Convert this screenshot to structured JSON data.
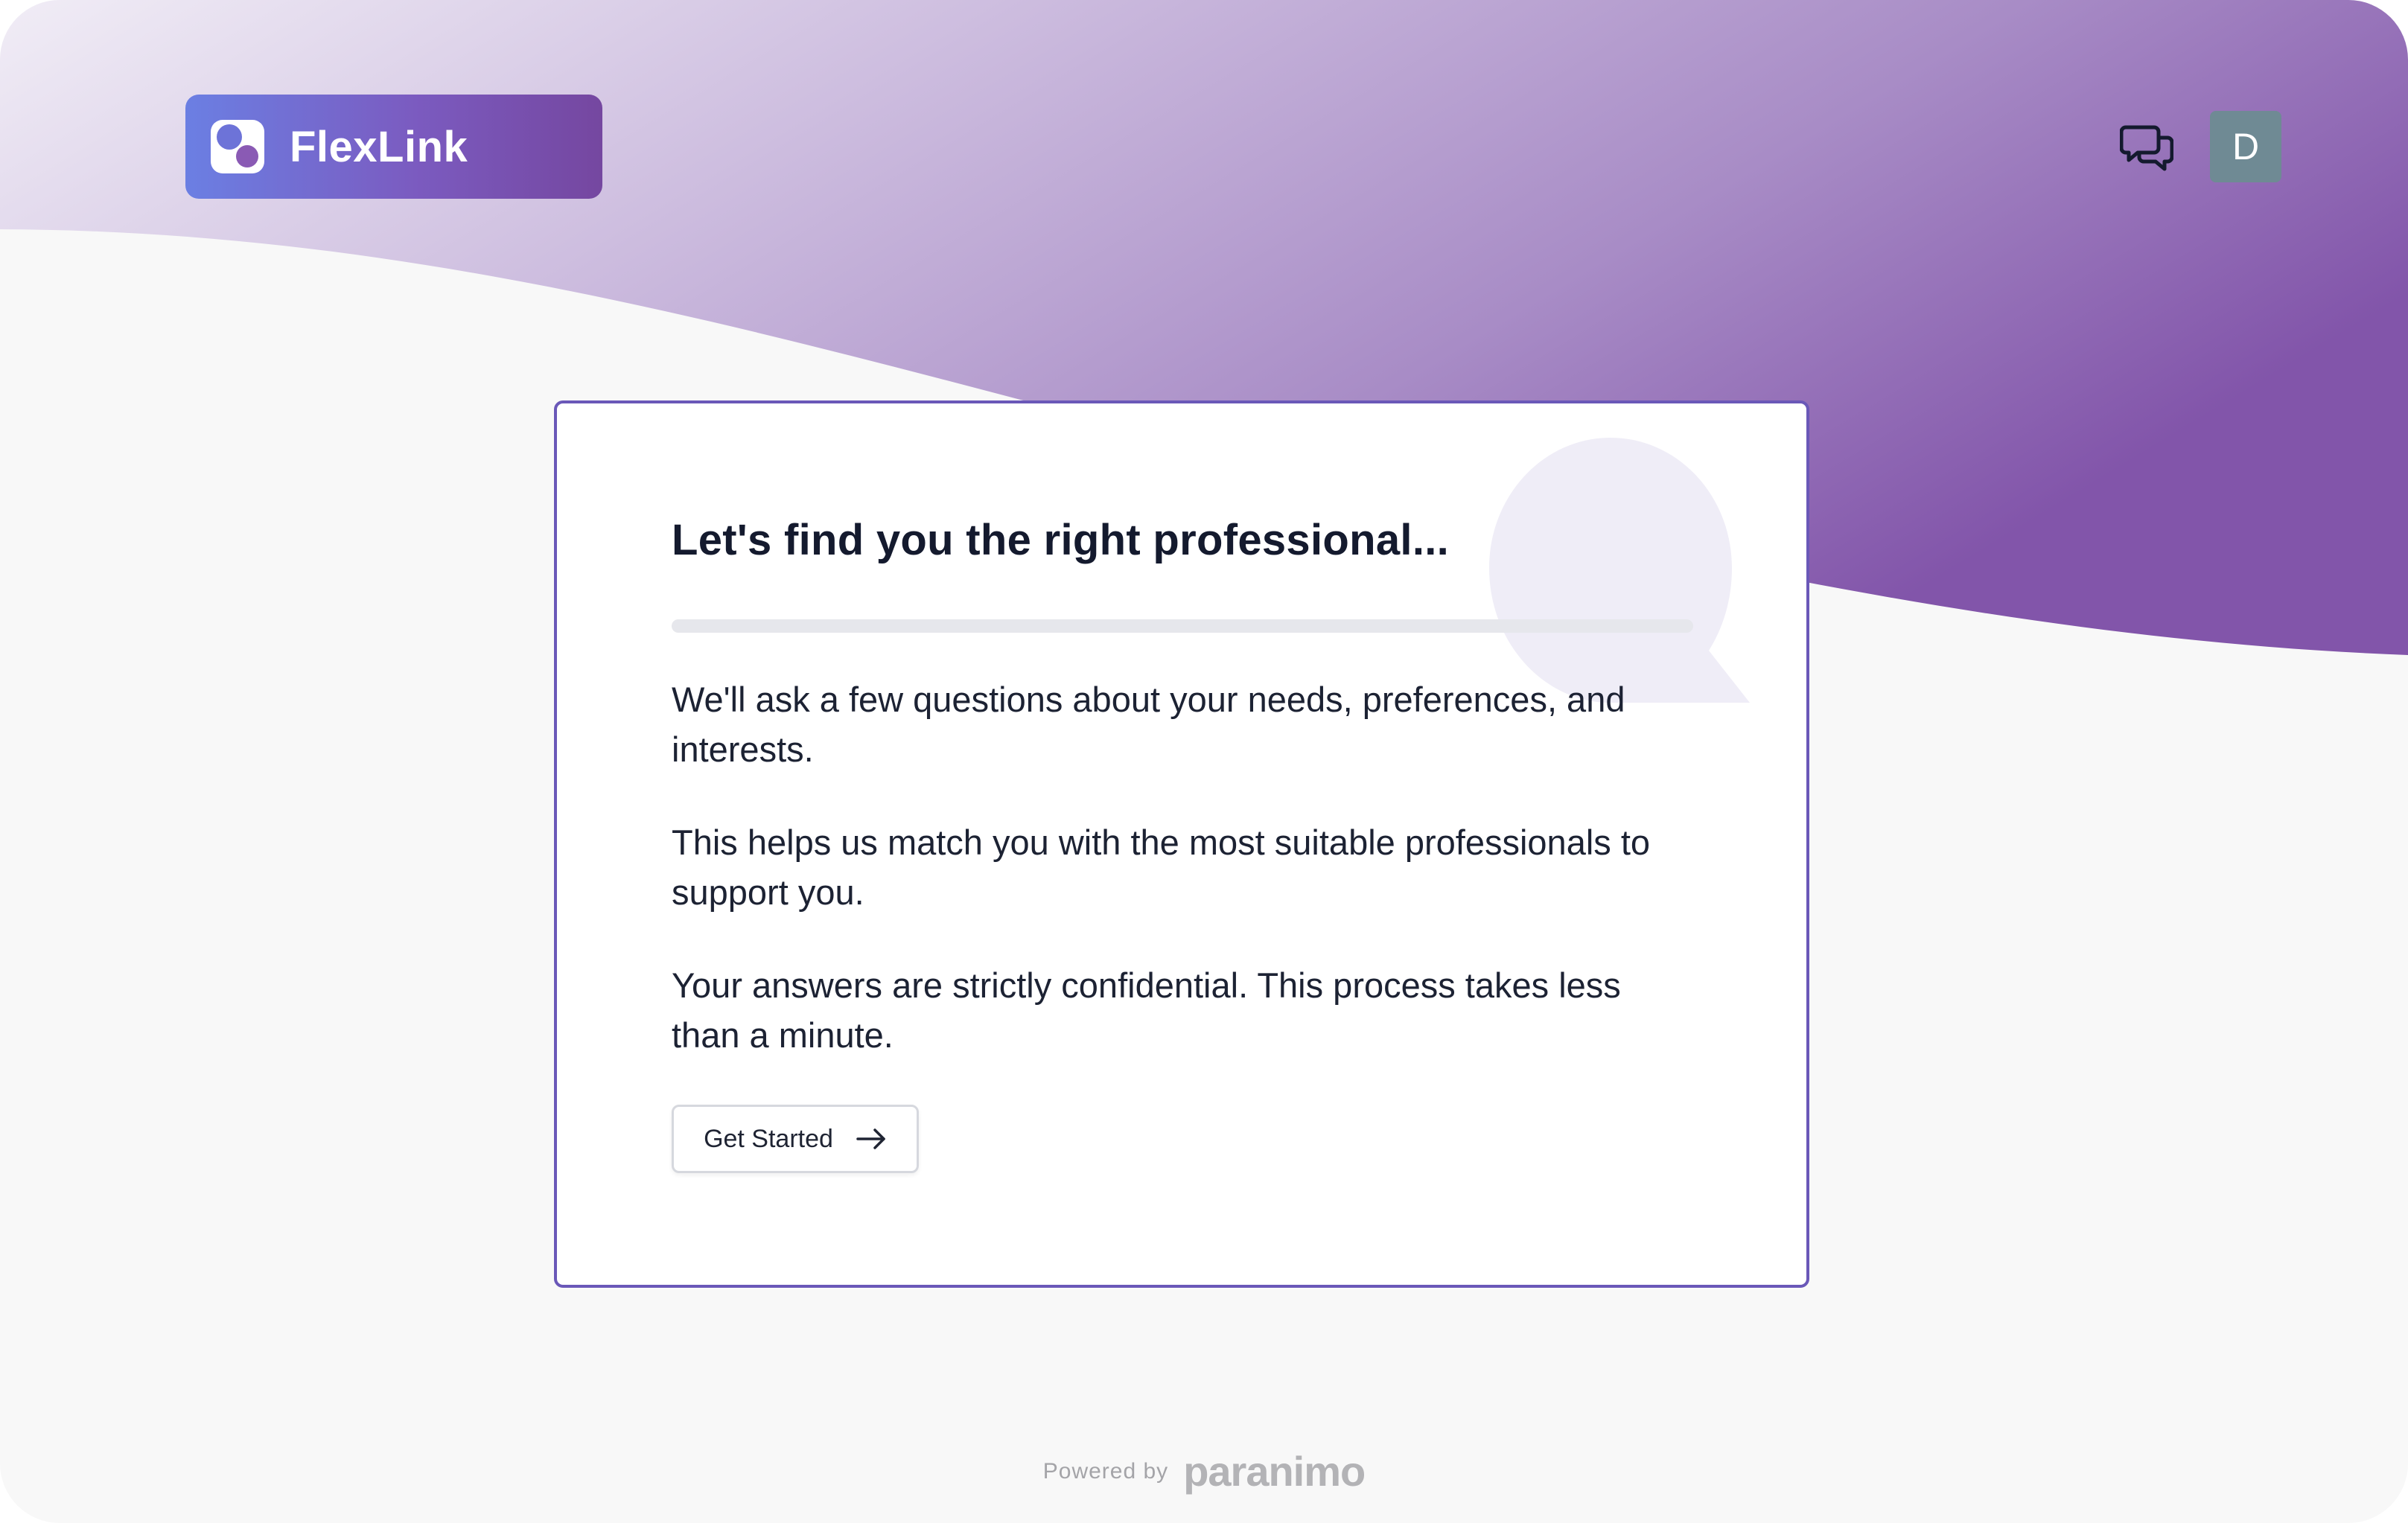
{
  "header": {
    "logo_text": "FlexLink",
    "logo_icon": "flexlink-logo-icon",
    "chat_icon": "chat-bubbles-icon",
    "avatar_initial": "D"
  },
  "card": {
    "title": "Let's find you the right professional...",
    "progress": 0,
    "paragraphs": [
      "We'll ask a few questions about your needs, preferences, and interests.",
      "This helps us match you with the most suitable professionals to support you.",
      "Your answers are strictly confidential. This process takes less than a minute."
    ],
    "button_label": "Get Started",
    "button_icon": "arrow-right-icon",
    "decor_icon": "speech-bubble-icon"
  },
  "footer": {
    "powered_by": "Powered by",
    "brand": "paranimo"
  },
  "colors": {
    "accent": "#6a58b8",
    "gradient_start": "#efeaf5",
    "gradient_end": "#8255aa",
    "avatar_bg": "#6f8a94",
    "page_bg": "#f8f8f8"
  }
}
